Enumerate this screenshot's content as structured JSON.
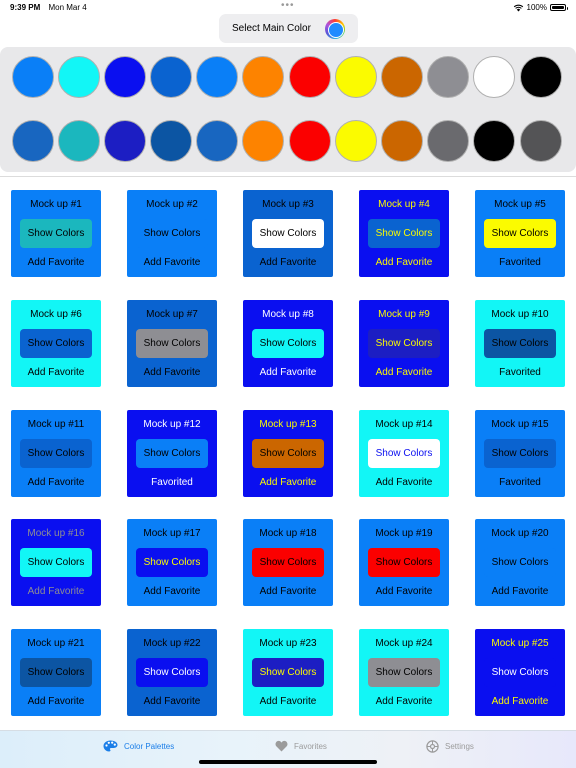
{
  "status_bar": {
    "time": "9:39 PM",
    "date": "Mon Mar 4",
    "dots": "•••",
    "battery": "100%"
  },
  "header": {
    "select_label": "Select Main Color",
    "main_color": "#1f8bff"
  },
  "palette": {
    "row1": [
      "#0a7ff7",
      "#12f6f6",
      "#0a0ff0",
      "#0a63d0",
      "#0a7ff7",
      "#fd8300",
      "#fb0000",
      "#fbfb00",
      "#cb6600",
      "#8e8e93",
      "#ffffff",
      "#000000"
    ],
    "row2": [
      "#1866c0",
      "#1bb7be",
      "#1c1ec3",
      "#0c55a3",
      "#1866c0",
      "#fd8300",
      "#fb0000",
      "#fbfb00",
      "#cb6600",
      "#6a6a6e",
      "#000000",
      "#545456"
    ]
  },
  "cards": [
    {
      "title": "Mock up #1",
      "button": "Show Colors",
      "fav": "Add Favorite",
      "bg": "#0a7ff7",
      "text": "#000000",
      "btn_bg": "#1bb7be",
      "btn_text": "#000000"
    },
    {
      "title": "Mock up #2",
      "button": "Show Colors",
      "fav": "Add Favorite",
      "bg": "#0a7ff7",
      "text": "#000000",
      "btn_bg": "#0a7ff7",
      "btn_text": "#000000"
    },
    {
      "title": "Mock up #3",
      "button": "Show Colors",
      "fav": "Add Favorite",
      "bg": "#0a63d0",
      "text": "#000000",
      "btn_bg": "#ffffff",
      "btn_text": "#000000"
    },
    {
      "title": "Mock up #4",
      "button": "Show Colors",
      "fav": "Add Favorite",
      "bg": "#0a0ff0",
      "text": "#fbfb00",
      "btn_bg": "#0a63d0",
      "btn_text": "#fbfb00"
    },
    {
      "title": "Mock up #5",
      "button": "Show Colors",
      "fav": "Favorited",
      "bg": "#0a7ff7",
      "text": "#000000",
      "btn_bg": "#fbfb00",
      "btn_text": "#000000"
    },
    {
      "title": "Mock up #6",
      "button": "Show Colors",
      "fav": "Add Favorite",
      "bg": "#12f6f6",
      "text": "#000000",
      "btn_bg": "#0a63d0",
      "btn_text": "#000000"
    },
    {
      "title": "Mock up #7",
      "button": "Show Colors",
      "fav": "Add Favorite",
      "bg": "#0a63d0",
      "text": "#000000",
      "btn_bg": "#8e8e93",
      "btn_text": "#000000"
    },
    {
      "title": "Mock up #8",
      "button": "Show Colors",
      "fav": "Add Favorite",
      "bg": "#0a0ff0",
      "text": "#ffffff",
      "btn_bg": "#12f6f6",
      "btn_text": "#000000"
    },
    {
      "title": "Mock up #9",
      "button": "Show Colors",
      "fav": "Add Favorite",
      "bg": "#0a0ff0",
      "text": "#fbfb00",
      "btn_bg": "#1c1ec3",
      "btn_text": "#fbfb00"
    },
    {
      "title": "Mock up #10",
      "button": "Show Colors",
      "fav": "Favorited",
      "bg": "#12f6f6",
      "text": "#000000",
      "btn_bg": "#0c55a3",
      "btn_text": "#000000"
    },
    {
      "title": "Mock up #11",
      "button": "Show Colors",
      "fav": "Add Favorite",
      "bg": "#0a7ff7",
      "text": "#000000",
      "btn_bg": "#0a63d0",
      "btn_text": "#000000"
    },
    {
      "title": "Mock up #12",
      "button": "Show Colors",
      "fav": "Favorited",
      "bg": "#0a0ff0",
      "text": "#ffffff",
      "btn_bg": "#0a7ff7",
      "btn_text": "#000000"
    },
    {
      "title": "Mock up #13",
      "button": "Show Colors",
      "fav": "Add Favorite",
      "bg": "#0a0ff0",
      "text": "#fbfb00",
      "btn_bg": "#cb6600",
      "btn_text": "#000000"
    },
    {
      "title": "Mock up #14",
      "button": "Show Colors",
      "fav": "Add Favorite",
      "bg": "#12f6f6",
      "text": "#000000",
      "btn_bg": "#ffffff",
      "btn_text": "#0a0ff0"
    },
    {
      "title": "Mock up #15",
      "button": "Show Colors",
      "fav": "Favorited",
      "bg": "#0a7ff7",
      "text": "#000000",
      "btn_bg": "#0a63d0",
      "btn_text": "#000000"
    },
    {
      "title": "Mock up #16",
      "button": "Show Colors",
      "fav": "Add Favorite",
      "bg": "#0a0ff0",
      "text": "#8e8e93",
      "btn_bg": "#12f6f6",
      "btn_text": "#000000"
    },
    {
      "title": "Mock up #17",
      "button": "Show Colors",
      "fav": "Add Favorite",
      "bg": "#0a7ff7",
      "text": "#000000",
      "btn_bg": "#0a0ff0",
      "btn_text": "#fbfb00"
    },
    {
      "title": "Mock up #18",
      "button": "Show Colors",
      "fav": "Add Favorite",
      "bg": "#0a7ff7",
      "text": "#000000",
      "btn_bg": "#fb0000",
      "btn_text": "#000000"
    },
    {
      "title": "Mock up #19",
      "button": "Show Colors",
      "fav": "Add Favorite",
      "bg": "#0a7ff7",
      "text": "#000000",
      "btn_bg": "#fb0000",
      "btn_text": "#000000"
    },
    {
      "title": "Mock up #20",
      "button": "Show Colors",
      "fav": "Add Favorite",
      "bg": "#0a7ff7",
      "text": "#000000",
      "btn_bg": "#0a7ff7",
      "btn_text": "#000000"
    },
    {
      "title": "Mock up #21",
      "button": "Show Colors",
      "fav": "Add Favorite",
      "bg": "#0a7ff7",
      "text": "#000000",
      "btn_bg": "#0c55a3",
      "btn_text": "#000000"
    },
    {
      "title": "Mock up #22",
      "button": "Show Colors",
      "fav": "Add Favorite",
      "bg": "#0a63d0",
      "text": "#000000",
      "btn_bg": "#0a0ff0",
      "btn_text": "#ffffff"
    },
    {
      "title": "Mock up #23",
      "button": "Show Colors",
      "fav": "Add Favorite",
      "bg": "#12f6f6",
      "text": "#000000",
      "btn_bg": "#1c1ec3",
      "btn_text": "#fbfb00"
    },
    {
      "title": "Mock up #24",
      "button": "Show Colors",
      "fav": "Add Favorite",
      "bg": "#12f6f6",
      "text": "#000000",
      "btn_bg": "#8e8e93",
      "btn_text": "#000000"
    },
    {
      "title": "Mock up #25",
      "button": "Show Colors",
      "fav": "Add Favorite",
      "bg": "#0a0ff0",
      "text": "#fbfb00",
      "btn_bg": "#0a0ff0",
      "btn_text": "#ffffff"
    }
  ],
  "tabs": [
    {
      "label": "Color Palettes",
      "icon": "palette-icon",
      "active": true
    },
    {
      "label": "Favorites",
      "icon": "heart-icon",
      "active": false
    },
    {
      "label": "Settings",
      "icon": "gear-icon",
      "active": false
    }
  ]
}
